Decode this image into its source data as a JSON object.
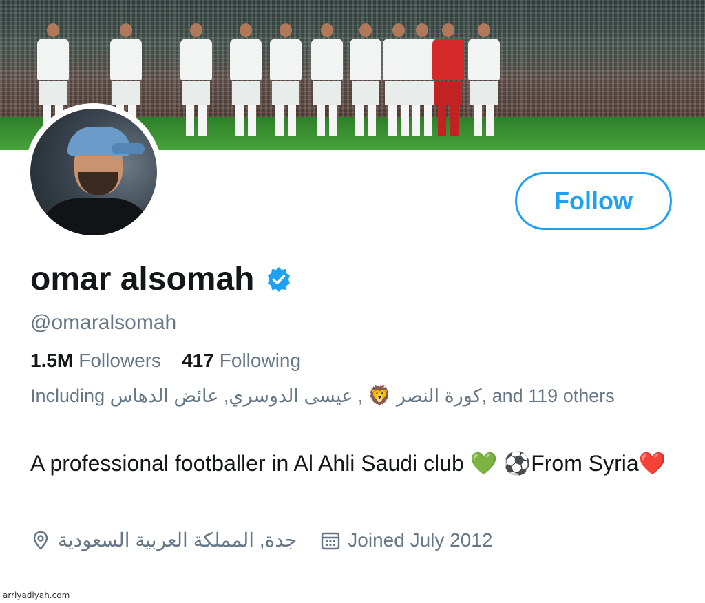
{
  "profile": {
    "display_name": "omar alsomah",
    "handle": "@omaralsomah",
    "verified": true,
    "follow_label": "Follow",
    "accent_color": "#1da1f2",
    "stats": {
      "followers_count": "1.5M",
      "followers_label": "Followers",
      "following_count": "417",
      "following_label": "Following"
    },
    "followed_by": "Including كورة النصر 🦁 , عيسى الدوسري, عائض الدهاس, and 119 others",
    "bio_line": "A professional footballer in Al Ahli Saudi club 💚 ⚽️From Syria❤️",
    "location": "جدة, المملكة العربية السعودية",
    "joined": "Joined July 2012",
    "icons": {
      "verified": "verified-badge-icon",
      "location": "location-pin-icon",
      "joined": "calendar-icon"
    }
  },
  "watermark": "arriyadiyah.com"
}
